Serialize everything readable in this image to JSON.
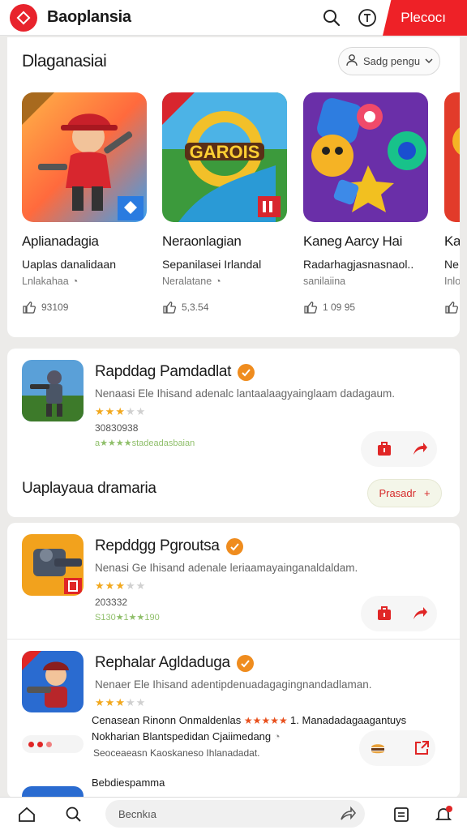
{
  "header": {
    "title": "Baoplansia",
    "cta": "Plecocı"
  },
  "featured": {
    "title": "Dlaganasiai",
    "sort_label": "Sadg pengu",
    "items": [
      {
        "name": "Aplianadagia",
        "subtitle": "Uaplas danalidaan",
        "developer": "Lnlakahaa",
        "likes": "93109"
      },
      {
        "name": "Neraonlagian",
        "subtitle": "Sepanilasei Irlandal",
        "developer": "Neralatane",
        "likes": "5,3.54"
      },
      {
        "name": "Kaneg Aarcy Hai",
        "subtitle": "Radarhagjasnasnaol..",
        "developer": "sanilaiina",
        "likes": "1 09 95"
      },
      {
        "name": "Ka",
        "subtitle": "Ne",
        "developer": "Inlo",
        "likes": ""
      }
    ],
    "thumb2_text": "GAROIS"
  },
  "list1": {
    "item": {
      "title": "Rapddag Pamdadlat",
      "desc": "Nenaasi Ele Ihisand adenalc lantaalaagyainglaam dadagaum.",
      "meta1": "30830938",
      "meta2": "a★★★★stadeadasbaian"
    },
    "section_title": "Uaplayaua dramaria",
    "section_btn": "Prasadr"
  },
  "list2": {
    "items": [
      {
        "title": "Repddgg Pgroutsa",
        "desc": "Nenasi Ge Ihisand adenale leriaamayainganaldaldam.",
        "meta1": "203332",
        "meta2": "S130★1★★190"
      },
      {
        "title": "Rephalar Agldaduga",
        "desc": "Nenaer Ele Ihisand adentipdenuadagagingnandadlaman.",
        "extra1": "Cenasean Rinonn Onmaldenlas",
        "extra1b": "1. Manadadagaagantuys",
        "extra2": "Nokharian Blantspedidan Cjaiimedang",
        "extra3": "Seoceaeasn Kaoskaneso Ihlanadadat.",
        "partial": "Bebdiespamma"
      }
    ]
  },
  "bottom_nav": {
    "search_placeholder": "Becnkıa"
  }
}
